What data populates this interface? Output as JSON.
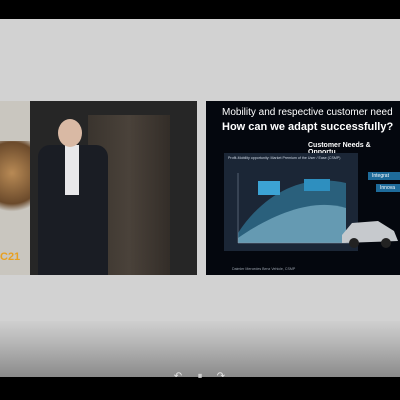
{
  "slide": {
    "title": "Mobility and respective customer need",
    "question": "How can we adapt successfully?",
    "section": "Customer Needs & Opportu",
    "chart_heading": "Profit-Mobility opportunity: Market Premium of the User / Ease (CSMP)",
    "tags": [
      "Integrat",
      "Innova"
    ],
    "source": "Daimler Mercedes Benz Vehicle, CSMP"
  },
  "venue": {
    "banner_text": "C21"
  },
  "player": {
    "icons": [
      "rewind-icon",
      "pause-icon",
      "forward-icon"
    ],
    "symbols": [
      "↶",
      "⏸",
      "↷"
    ],
    "state": "playing"
  },
  "colors": {
    "slide_bg": "#04070e",
    "accent_blue": "#1e6b9a",
    "banner_orange": "#e8a020"
  }
}
